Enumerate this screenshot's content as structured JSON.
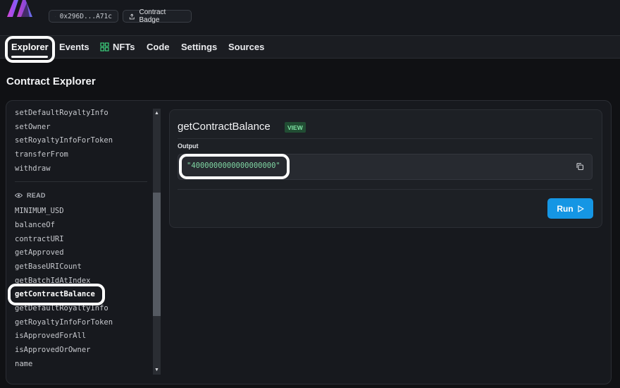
{
  "header": {
    "address_chip": {
      "text": "0x296D...A71c",
      "icon": "copy-icon"
    },
    "badge_chip": {
      "text": "Contract Badge",
      "icon": "share-icon"
    }
  },
  "tabs": [
    {
      "label": "Explorer",
      "active": true
    },
    {
      "label": "Events"
    },
    {
      "label": "NFTs",
      "icon": "grid-icon",
      "icon_color": "#3ccf7c"
    },
    {
      "label": "Code"
    },
    {
      "label": "Settings"
    },
    {
      "label": "Sources"
    }
  ],
  "page_title": "Contract Explorer",
  "function_list": {
    "write_items": [
      "setDefaultRoyaltyInfo",
      "setOwner",
      "setRoyaltyInfoForToken",
      "transferFrom",
      "withdraw"
    ],
    "read_section_label": "READ",
    "read_section_icon": "eye-icon",
    "read_items": [
      "MINIMUM_USD",
      "balanceOf",
      "contractURI",
      "getApproved",
      "getBaseURICount",
      "getBatchIdAtIndex",
      "getContractBalance",
      "getDefaultRoyaltyInfo",
      "getRoyaltyInfoForToken",
      "isApprovedForAll",
      "isApprovedOrOwner",
      "name"
    ],
    "selected": "getContractBalance"
  },
  "function_panel": {
    "name": "getContractBalance",
    "badge": "VIEW",
    "output_label": "Output",
    "output_value": "\"4000000000000000000\"",
    "run_label": "Run"
  },
  "colors": {
    "accent": "#1596e4",
    "output_text": "#7fd6a3",
    "view_badge_bg": "#214d33",
    "view_badge_text": "#7fe2a4"
  }
}
